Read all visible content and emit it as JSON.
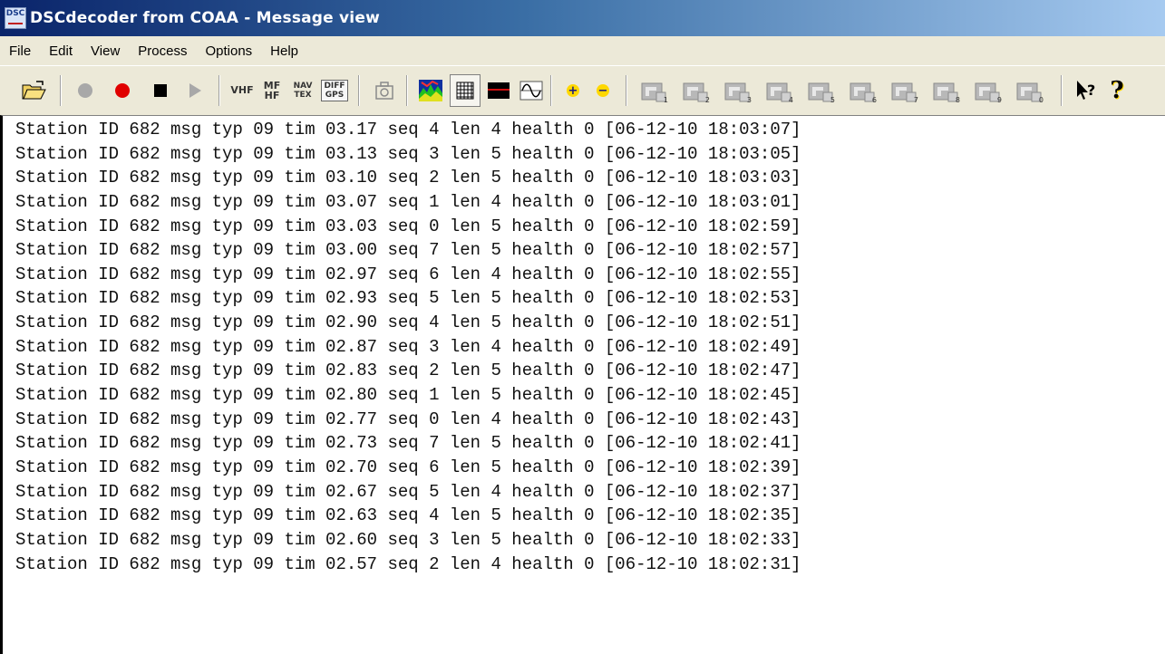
{
  "window": {
    "title": "DSCdecoder from COAA - Message view",
    "app_icon_text": "DSC"
  },
  "menu": [
    "File",
    "Edit",
    "View",
    "Process",
    "Options",
    "Help"
  ],
  "toolbar": {
    "vhf": "VHF",
    "mf_top": "MF",
    "mf_bottom": "HF",
    "nav_top": "NAV",
    "nav_bottom": "TEX",
    "diff_top": "DIFF",
    "diff_bottom": "GPS",
    "help_mark": "?",
    "minus_sign": "−",
    "plus_sign": "+",
    "channel_buttons": [
      "1",
      "2",
      "3",
      "4",
      "5",
      "6",
      "7",
      "8",
      "9",
      "0"
    ]
  },
  "colors": {
    "record_red": "#e00000",
    "zoom_yellow": "#ffd800",
    "title_blue": "#0a246a"
  },
  "messages": [
    "Station ID 682 msg typ 09 tim 03.17 seq 4 len 4 health 0 [06-12-10 18:03:07]",
    "Station ID 682 msg typ 09 tim 03.13 seq 3 len 5 health 0 [06-12-10 18:03:05]",
    "Station ID 682 msg typ 09 tim 03.10 seq 2 len 5 health 0 [06-12-10 18:03:03]",
    "Station ID 682 msg typ 09 tim 03.07 seq 1 len 4 health 0 [06-12-10 18:03:01]",
    "Station ID 682 msg typ 09 tim 03.03 seq 0 len 5 health 0 [06-12-10 18:02:59]",
    "Station ID 682 msg typ 09 tim 03.00 seq 7 len 5 health 0 [06-12-10 18:02:57]",
    "Station ID 682 msg typ 09 tim 02.97 seq 6 len 4 health 0 [06-12-10 18:02:55]",
    "Station ID 682 msg typ 09 tim 02.93 seq 5 len 5 health 0 [06-12-10 18:02:53]",
    "Station ID 682 msg typ 09 tim 02.90 seq 4 len 5 health 0 [06-12-10 18:02:51]",
    "Station ID 682 msg typ 09 tim 02.87 seq 3 len 4 health 0 [06-12-10 18:02:49]",
    "Station ID 682 msg typ 09 tim 02.83 seq 2 len 5 health 0 [06-12-10 18:02:47]",
    "Station ID 682 msg typ 09 tim 02.80 seq 1 len 5 health 0 [06-12-10 18:02:45]",
    "Station ID 682 msg typ 09 tim 02.77 seq 0 len 4 health 0 [06-12-10 18:02:43]",
    "Station ID 682 msg typ 09 tim 02.73 seq 7 len 5 health 0 [06-12-10 18:02:41]",
    "Station ID 682 msg typ 09 tim 02.70 seq 6 len 5 health 0 [06-12-10 18:02:39]",
    "Station ID 682 msg typ 09 tim 02.67 seq 5 len 4 health 0 [06-12-10 18:02:37]",
    "Station ID 682 msg typ 09 tim 02.63 seq 4 len 5 health 0 [06-12-10 18:02:35]",
    "Station ID 682 msg typ 09 tim 02.60 seq 3 len 5 health 0 [06-12-10 18:02:33]",
    "Station ID 682 msg typ 09 tim 02.57 seq 2 len 4 health 0 [06-12-10 18:02:31]"
  ]
}
